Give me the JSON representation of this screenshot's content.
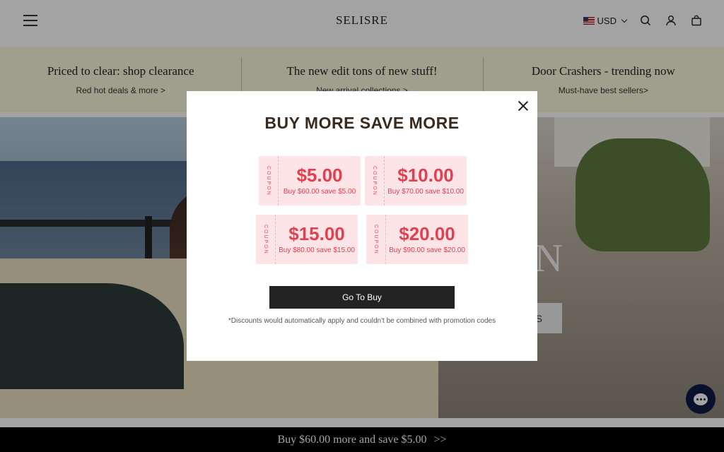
{
  "header": {
    "brand": "SELISRE",
    "currency": "USD",
    "icons": [
      "menu-icon",
      "us-flag-icon",
      "chevron-down-icon",
      "search-icon",
      "account-icon",
      "cart-icon"
    ]
  },
  "promos": [
    {
      "title": "Priced to clear: shop clearance",
      "link": "Red hot deals & more >"
    },
    {
      "title": "The new edit tons of new stuff!",
      "link": "New arrival collections >"
    },
    {
      "title": "Door Crashers - trending now",
      "link": "Must-have best sellers>"
    }
  ],
  "hero": {
    "text_fragment": "IN",
    "button_fragment": "S"
  },
  "modal": {
    "title": "BUY MORE SAVE MORE",
    "coupons": [
      {
        "side": "COUPON",
        "amount": "$5.00",
        "desc": "Buy $60.00 save $5.00"
      },
      {
        "side": "COUPON",
        "amount": "$10.00",
        "desc": "Buy $70.00 save $10.00"
      },
      {
        "side": "COUPON",
        "amount": "$15.00",
        "desc": "Buy $80.00 save $15.00"
      },
      {
        "side": "COUPON",
        "amount": "$20.00",
        "desc": "Buy $90.00 save $20.00"
      }
    ],
    "cta": "Go To Buy",
    "disclaimer": "*Discounts would automatically apply and couldn't be combined with promotion codes"
  },
  "bottom_bar": {
    "text": "Buy $60.00 more and save $5.00",
    "arrows": ">>"
  },
  "colors": {
    "promo_bg": "#fbf7dc",
    "coupon_bg": "#fde4e6",
    "coupon_red": "#e0404f",
    "title_brown": "#3a2a1e",
    "cta_bg": "#232323",
    "chat_bg": "#0f1a44"
  }
}
